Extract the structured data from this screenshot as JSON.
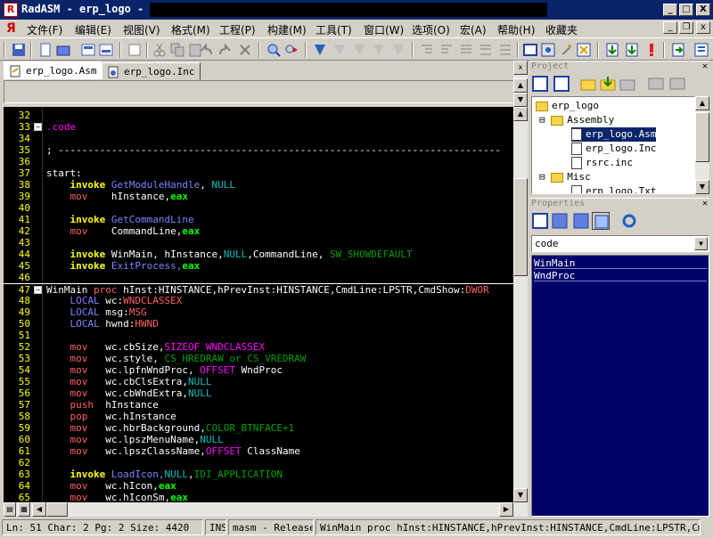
{
  "window": {
    "app_icon": "radasm-icon",
    "title": "RadASM - erp_logo - [D:\\",
    "path_value": "",
    "minimize": "_",
    "maximize": "□",
    "close": "X"
  },
  "menu": {
    "items": [
      "文件(F)",
      "编辑(E)",
      "视图(V)",
      "格式(M)",
      "工程(P)",
      "构建(M)",
      "工具(T)",
      "窗口(W)",
      "选项(O)",
      "宏(A)",
      "帮助(H)",
      "收藏夹"
    ]
  },
  "tabs": [
    {
      "label": "erp_logo.Asm",
      "active": true
    },
    {
      "label": "erp_logo.Inc",
      "active": false
    }
  ],
  "code_lines": [
    {
      "n": "32",
      "fold": false
    },
    {
      "n": "33",
      "fold": true
    },
    {
      "n": "34",
      "fold": false
    },
    {
      "n": "35",
      "fold": false
    },
    {
      "n": "36",
      "fold": false
    },
    {
      "n": "37",
      "fold": false
    },
    {
      "n": "38",
      "fold": false
    },
    {
      "n": "39",
      "fold": false
    },
    {
      "n": "40",
      "fold": false
    },
    {
      "n": "41",
      "fold": false
    },
    {
      "n": "42",
      "fold": false
    },
    {
      "n": "43",
      "fold": false
    },
    {
      "n": "44",
      "fold": false
    },
    {
      "n": "45",
      "fold": false
    },
    {
      "n": "46",
      "fold": false
    },
    {
      "n": "47",
      "fold": true
    },
    {
      "n": "48",
      "fold": false
    },
    {
      "n": "49",
      "fold": false
    },
    {
      "n": "50",
      "fold": false
    },
    {
      "n": "51",
      "fold": false
    },
    {
      "n": "52",
      "fold": false
    },
    {
      "n": "53",
      "fold": false
    },
    {
      "n": "54",
      "fold": false
    },
    {
      "n": "55",
      "fold": false
    },
    {
      "n": "56",
      "fold": false
    },
    {
      "n": "57",
      "fold": false
    },
    {
      "n": "58",
      "fold": false
    },
    {
      "n": "59",
      "fold": false
    },
    {
      "n": "60",
      "fold": false
    },
    {
      "n": "61",
      "fold": false
    },
    {
      "n": "62",
      "fold": false
    },
    {
      "n": "63",
      "fold": false
    },
    {
      "n": "64",
      "fold": false
    },
    {
      "n": "65",
      "fold": false
    }
  ],
  "code_text": {
    "l33": ".code",
    "l35": "; ---------------------------------------------------------------------------",
    "l37": "start:",
    "l38_a": "invoke",
    "l38_b": "GetModuleHandle",
    "l38_c": ", ",
    "l38_d": "NULL",
    "l39_a": "mov",
    "l39_b": "hInstance,",
    "l39_c": "eax",
    "l41_a": "invoke",
    "l41_b": "GetCommandLine",
    "l42_a": "mov",
    "l42_b": "CommandLine,",
    "l42_c": "eax",
    "l44_a": "invoke",
    "l44_b": "WinMain, hInstance,",
    "l44_c": "NULL",
    "l44_d": ",CommandLine, ",
    "l44_e": "SW_SHOWDEFAULT",
    "l45_a": "invoke",
    "l45_b": "ExitProcess,",
    "l45_c": "eax",
    "l47_a": "WinMain ",
    "l47_b": "proc",
    "l47_c": " hInst:HINSTANCE,hPrevInst:HINSTANCE,CmdLine:LPSTR,CmdShow:",
    "l47_d": "DWOR",
    "l48_a": "LOCAL",
    "l48_b": " wc:",
    "l48_c": "WNDCLASSEX",
    "l49_a": "LOCAL",
    "l49_b": " msg:",
    "l49_c": "MSG",
    "l50_a": "LOCAL",
    "l50_b": " hwnd:",
    "l50_c": "HWND",
    "l52_a": "mov",
    "l52_b": "wc.cbSize,",
    "l52_c": "SIZEOF WNDCLASSEX",
    "l53_a": "mov",
    "l53_b": "wc.style, ",
    "l53_c": "CS_HREDRAW or CS_VREDRAW",
    "l54_a": "mov",
    "l54_b": "wc.lpfnWndProc, ",
    "l54_c": "OFFSET",
    "l54_d": " WndProc",
    "l55_a": "mov",
    "l55_b": "wc.cbClsExtra,",
    "l55_c": "NULL",
    "l56_a": "mov",
    "l56_b": "wc.cbWndExtra,",
    "l56_c": "NULL",
    "l57_a": "push",
    "l57_b": "hInstance",
    "l58_a": "pop",
    "l58_b": "wc.hInstance",
    "l59_a": "mov",
    "l59_b": "wc.hbrBackground,",
    "l59_c": "COLOR_BTNFACE+1",
    "l60_a": "mov",
    "l60_b": "wc.lpszMenuName,",
    "l60_c": "NULL",
    "l61_a": "mov",
    "l61_b": "wc.lpszClassName,",
    "l61_c": "OFFSET",
    "l61_d": " ClassName",
    "l63_a": "invoke",
    "l63_b": "LoadIcon,",
    "l63_c": "NULL",
    "l63_d": ",",
    "l63_e": "IDI_APPLICATION",
    "l64_a": "mov",
    "l64_b": "wc.hIcon,",
    "l64_c": "eax",
    "l65_a": "mov",
    "l65_b": "wc.hIconSm,",
    "l65_c": "eax"
  },
  "project": {
    "title": "Project",
    "root": "erp_logo",
    "assembly": "Assembly",
    "files": [
      "erp_logo.Asm",
      "erp_logo.Inc",
      "rsrc.inc"
    ],
    "misc": "Misc",
    "misc_files": [
      "erp_logo.Txt"
    ]
  },
  "properties": {
    "title": "Properties",
    "combo_value": "code",
    "items": [
      "WinMain",
      "WndProc"
    ]
  },
  "status": {
    "position": "Ln: 51 Char: 2 Pg: 2 Size: 4420",
    "mode": "INS",
    "build": "masm - Release",
    "proc": "WinMain proc hInst:HINSTANCE,hPrevInst:HINSTANCE,CmdLine:LPSTR,CmdShow:"
  },
  "colors": {
    "editor_bg": "#000000",
    "keyword": "#ffff00",
    "api": "#8080ff",
    "constant": "#00c0c0",
    "register": "#00ff00",
    "props_bg": "#00006a"
  }
}
